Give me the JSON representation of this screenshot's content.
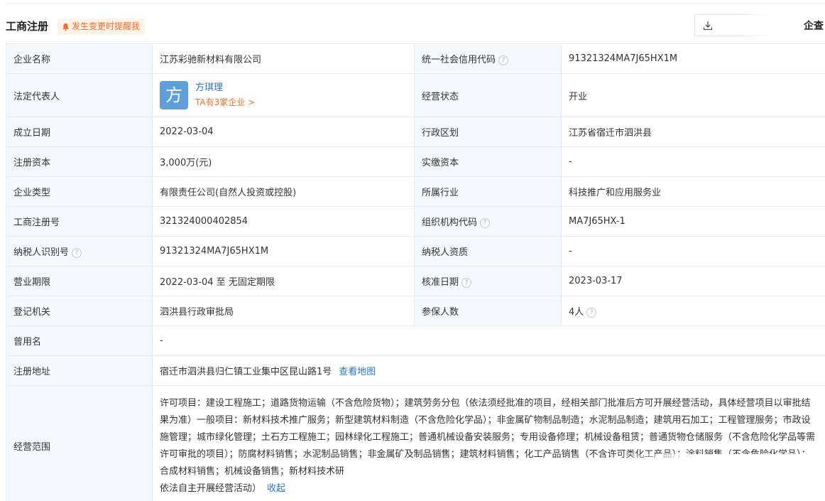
{
  "header": {
    "title": "工商注册",
    "reminder_label": "发生变更时提醒我",
    "right_label": "企查"
  },
  "rows": [
    {
      "l1": "企业名称",
      "v1": "江苏彩驰新材料有限公司",
      "l2": "统一社会信用代码",
      "v2": "91321324MA7J65HX1M"
    },
    {
      "l1": "法定代表人",
      "l2": "经营状态",
      "v2": "开业"
    },
    {
      "l1": "成立日期",
      "v1": "2022-03-04",
      "l2": "行政区划",
      "v2": "江苏省宿迁市泗洪县"
    },
    {
      "l1": "注册资本",
      "v1": "3,000万(元)",
      "l2": "实缴资本",
      "v2": "-"
    },
    {
      "l1": "企业类型",
      "v1": "有限责任公司(自然人投资或控股)",
      "l2": "所属行业",
      "v2": "科技推广和应用服务业"
    },
    {
      "l1": "工商注册号",
      "v1": "321324000402854",
      "l2": "组织机构代码",
      "v2": "MA7J65HX-1"
    },
    {
      "l1": "纳税人识别号",
      "v1": "91321324MA7J65HX1M",
      "l2": "纳税人资质",
      "v2": "-"
    },
    {
      "l1": "营业期限",
      "v1": "2022-03-04 至 无固定期限",
      "l2": "核准日期",
      "v2": "2023-03-17"
    },
    {
      "l1": "登记机关",
      "v1": "泗洪县行政审批局",
      "l2": "参保人数",
      "v2": "4人"
    },
    {
      "l1": "曾用名",
      "v1": "-"
    },
    {
      "l1": "注册地址",
      "v1": "宿迁市泗洪县归仁镇工业集中区昆山路1号",
      "link": "查看地图"
    },
    {
      "l1": "经营范围",
      "v1": "许可项目：建设工程施工；道路货物运输（不含危险货物）；建筑劳务分包（依法须经批准的项目，经相关部门批准后方可开展经营活动，具体经营项目以审批结果为准）一般项目：新材料技术推广服务；新型建筑材料制造（不含危险化学品）；非金属矿物制品制造；水泥制品制造；建筑用石加工；工程管理服务；市政设施管理；城市绿化管理；土石方工程施工；园林绿化工程施工；普通机械设备安装服务；专用设备修理；机械设备租赁；普通货物仓储服务（不含危险化学品等需许可审批的项目）；防腐材料销售；水泥制品销售；非金属矿及制品销售；建筑材料销售；化工产品销售（不含许可类化工产品）；涂料销售（不含危险化学品）；合成材料销售；机械设备销售；新材料技术研",
      "tail": "依法自主开展经营活动）",
      "link": "收起"
    }
  ],
  "legal_rep": {
    "avatar_char": "方",
    "name": "方琪理",
    "companies_link": "TA有3家企业 >"
  },
  "colors": {
    "accent_blue": "#2c75c4",
    "accent_orange": "#f46e26",
    "label_bg": "#f5f8fc",
    "border": "#e7ecf1"
  },
  "icons": [
    "bell-icon",
    "download-icon",
    "help-circle-icon"
  ]
}
